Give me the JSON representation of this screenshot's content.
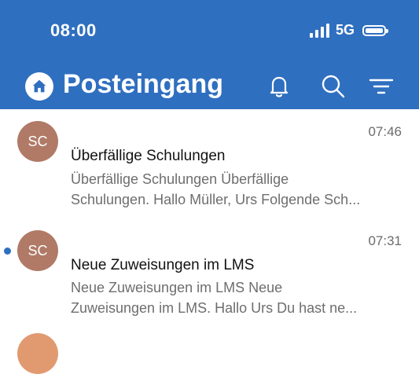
{
  "status_bar": {
    "time": "08:00",
    "network": "5G"
  },
  "header": {
    "title": "Posteingang"
  },
  "icons": {
    "home": "home-icon",
    "bell": "bell-icon",
    "search": "search-icon",
    "filter": "filter-icon"
  },
  "colors": {
    "header_bg": "#2f6fc0",
    "avatar": "#b07a67",
    "unread_dot": "#2f6fc0"
  },
  "messages": [
    {
      "avatar": "SC",
      "time": "07:46",
      "subject": "Überfällige Schulungen",
      "preview_line1": "Überfällige Schulungen Überfällige",
      "preview_line2": "Schulungen. Hallo Müller, Urs Folgende Sch...",
      "unread": false
    },
    {
      "avatar": "SC",
      "time": "07:31",
      "subject": "Neue Zuweisungen im LMS",
      "preview_line1": "Neue Zuweisungen im LMS Neue",
      "preview_line2": "Zuweisungen im LMS. Hallo Urs Du hast ne...",
      "unread": true
    }
  ]
}
